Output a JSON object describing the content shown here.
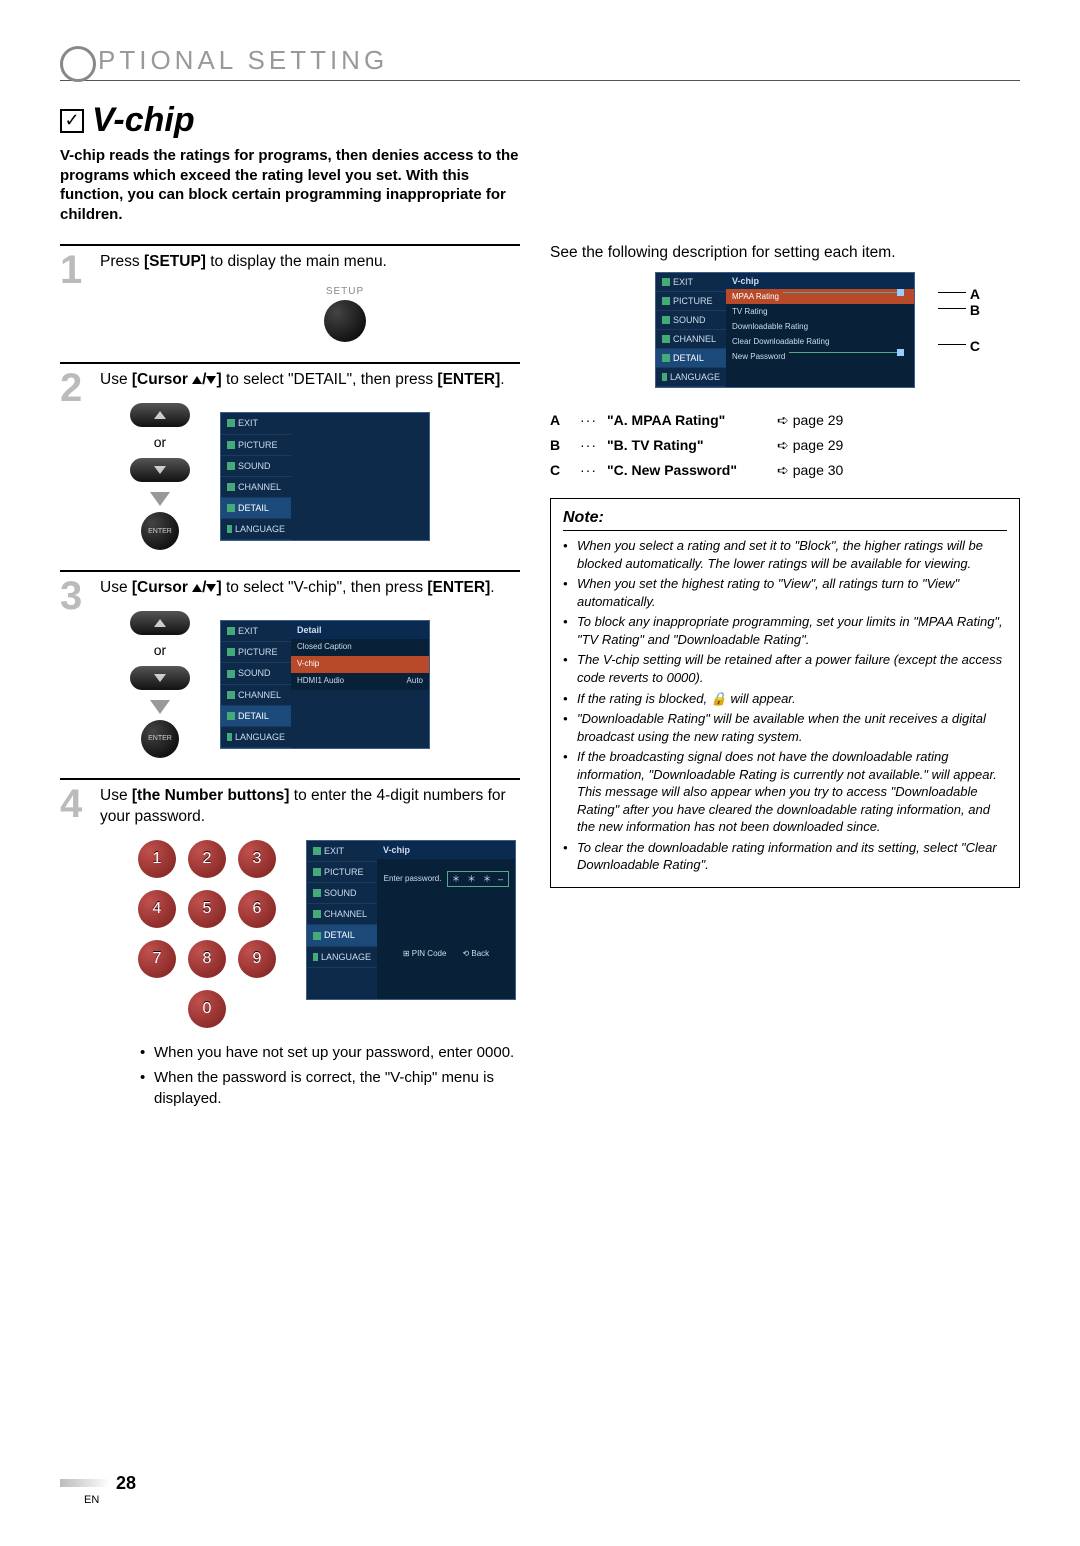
{
  "header": "PTIONAL   SETTING",
  "section": {
    "title": "V-chip"
  },
  "intro": "V-chip reads the ratings for programs, then denies access to the programs which exceed the rating level you set. With this function, you can block certain programming inappropriate for children.",
  "steps": {
    "s1": {
      "num": "1",
      "t1": "Press ",
      "b1": "[SETUP]",
      "t2": " to display the main menu.",
      "setup_label": "SETUP"
    },
    "s2": {
      "num": "2",
      "t1": "Use ",
      "b1": "[Cursor ",
      "t2": "]",
      "t3": " to select \"DETAIL\", then press ",
      "b2": "[ENTER]",
      "t4": ".",
      "or": "or",
      "enter": "ENTER"
    },
    "s3": {
      "num": "3",
      "t1": "Use ",
      "b1": "[Cursor ",
      "t2": "]",
      "t3": " to select \"V-chip\", then press ",
      "b2": "[ENTER]",
      "t4": ".",
      "or": "or",
      "enter": "ENTER"
    },
    "s4": {
      "num": "4",
      "t1": "Use ",
      "b1": "[the Number buttons]",
      "t2": " to enter the 4-digit numbers for your password."
    }
  },
  "osd_menu": {
    "items": [
      "EXIT",
      "PICTURE",
      "SOUND",
      "CHANNEL",
      "DETAIL",
      "LANGUAGE"
    ]
  },
  "osd3": {
    "title": "Detail",
    "rows": [
      {
        "l": "Closed Caption",
        "r": ""
      },
      {
        "l": "V-chip",
        "r": ""
      },
      {
        "l": "HDMI1 Audio",
        "r": "Auto"
      }
    ]
  },
  "osd4": {
    "title": "V-chip",
    "enter_pw": "Enter password.",
    "mask": "＊ ＊ ＊ –",
    "hint_pin": "PIN Code",
    "hint_back": "Back"
  },
  "keypad": [
    "1",
    "2",
    "3",
    "4",
    "5",
    "6",
    "7",
    "8",
    "9",
    "0"
  ],
  "sub_bullets": [
    "When you have not set up your password, enter 0000.",
    "When the password is correct, the \"V-chip\" menu is displayed."
  ],
  "right": {
    "desc": "See the following description for setting each item.",
    "osd_title": "V-chip",
    "osd_items": [
      "MPAA Rating",
      "TV Rating",
      "Downloadable Rating",
      "Clear Downloadable Rating",
      "New Password"
    ],
    "callouts": {
      "a": "A",
      "b": "B",
      "c": "C"
    }
  },
  "refs": [
    {
      "k": "A",
      "name": "\"A. MPAA Rating\"",
      "page": "page 29"
    },
    {
      "k": "B",
      "name": "\"B. TV Rating\"",
      "page": "page 29"
    },
    {
      "k": "C",
      "name": "\"C. New Password\"",
      "page": "page 30"
    }
  ],
  "note": {
    "title": "Note:",
    "items": [
      "When you select a rating and set it to \"Block\", the higher ratings will be blocked automatically. The lower ratings will be available for viewing.",
      "When you set the highest rating to \"View\", all ratings turn to \"View\" automatically.",
      "To block any inappropriate programming, set your limits in \"MPAA Rating\", \"TV Rating\" and \"Downloadable Rating\".",
      "The V-chip setting will be retained after a power failure (except the access code reverts to 0000).",
      "If the rating is blocked, 🔒 will appear.",
      "\"Downloadable Rating\" will be available when the unit receives a digital broadcast using the new rating system.",
      "If the broadcasting signal does not have the downloadable rating information, \"Downloadable Rating is currently not available.\" will appear.\nThis message will also appear when you try to access \"Downloadable Rating\" after you have cleared the downloadable rating information, and the new information has not been downloaded since.",
      "To clear the downloadable rating information and its setting, select \"Clear Downloadable Rating\"."
    ]
  },
  "footer": {
    "page": "28",
    "lang": "EN"
  }
}
